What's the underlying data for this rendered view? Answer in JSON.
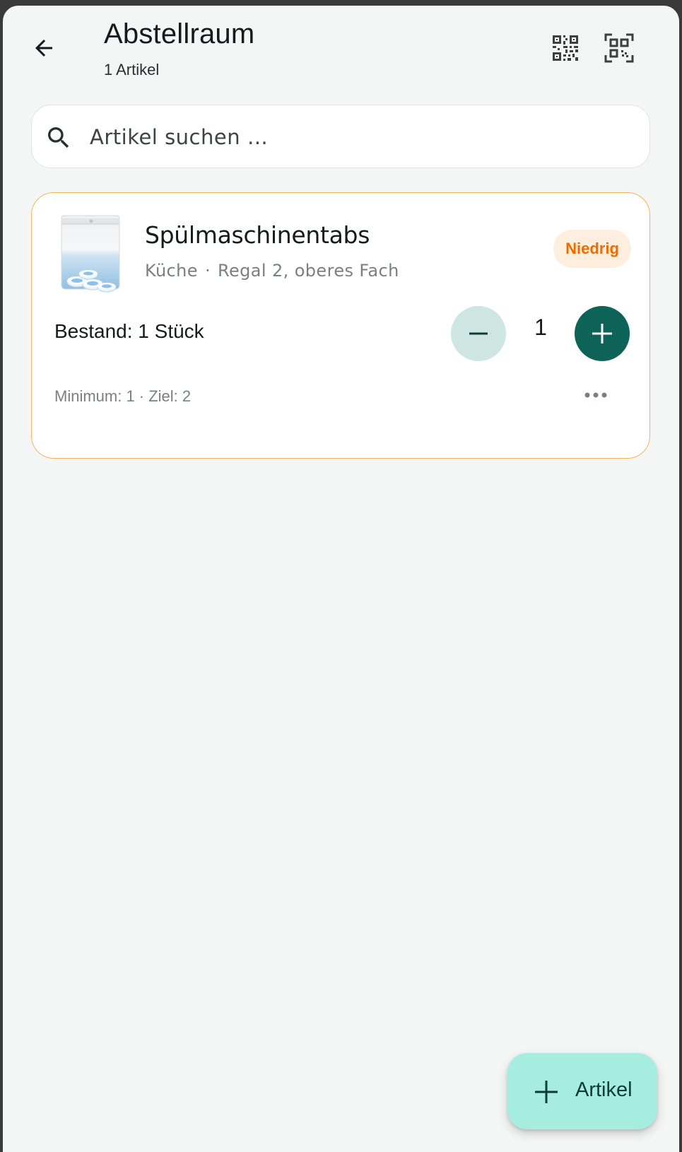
{
  "header": {
    "title": "Abstellraum",
    "subtitle": "1 Artikel",
    "back_icon": "arrow-left-icon",
    "qr_icon": "qr-code-icon",
    "scan_icon": "qr-scan-icon"
  },
  "search": {
    "placeholder": "Artikel suchen …",
    "icon": "search-icon"
  },
  "items": [
    {
      "name": "Spülmaschinentabs",
      "room": "Küche",
      "separator": "·",
      "place": "Regal 2, oberes Fach",
      "status": "Niedrig",
      "stock_label": "Bestand: 1 Stück",
      "quantity": "1",
      "minmax": "Minimum: 1 · Ziel: 2",
      "status_color": "#ef6b00"
    }
  ],
  "fab": {
    "label": "Artikel",
    "icon": "plus-icon"
  },
  "colors": {
    "accent": "#0e6358",
    "accent_light": "#cde6e1",
    "fab": "#a6eddf",
    "warning_border": "#f5b25a",
    "warning_bg": "#fdeedd"
  }
}
